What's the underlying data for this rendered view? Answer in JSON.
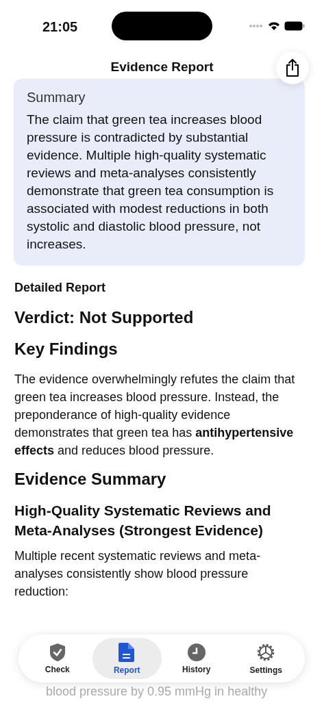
{
  "status_bar": {
    "time": "21:05"
  },
  "header": {
    "title": "Evidence Report"
  },
  "summary": {
    "title": "Summary",
    "text": "The claim that green tea increases blood pressure is contradicted by substantial evidence. Multiple high-quality systematic reviews and meta-analyses consistently demonstrate that green tea consumption is associated with modest reductions in both systolic and diastolic blood pressure, not increases."
  },
  "report": {
    "label": "Detailed Report",
    "blocks": [
      {
        "kind": "h2",
        "text": "Verdict: Not Supported"
      },
      {
        "kind": "h2",
        "text": "Key Findings"
      },
      {
        "kind": "p",
        "text": "The evidence overwhelmingly refutes the claim that green tea increases blood pressure. Instead, the preponderance of high-quality evidence demonstrates that green tea has **antihypertensive effects** and reduces blood pressure."
      },
      {
        "kind": "h2",
        "text": "Evidence Summary"
      },
      {
        "kind": "h3",
        "text": "High-Quality Systematic Reviews and Meta-Analyses (Strongest Evidence)"
      },
      {
        "kind": "p",
        "text": "Multiple recent systematic reviews and meta-analyses consistently show blood pressure reduction:"
      },
      {
        "kind": "faded",
        "text": "blood pressure by 0.95 mmHg in healthy"
      }
    ]
  },
  "tabs": [
    {
      "label": "Check",
      "kind": "shield",
      "selected": false
    },
    {
      "label": "Report",
      "kind": "doc",
      "selected": true
    },
    {
      "label": "History",
      "kind": "clock",
      "selected": false
    },
    {
      "label": "Settings",
      "kind": "gear",
      "selected": false
    }
  ]
}
